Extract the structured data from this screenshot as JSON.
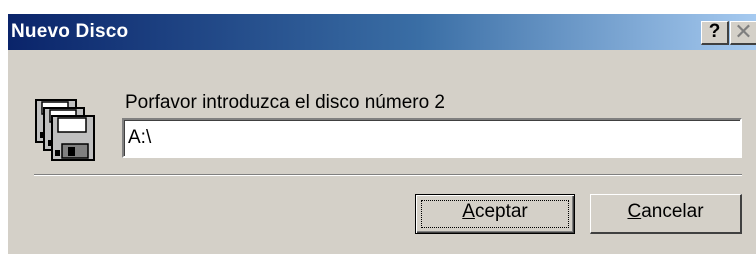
{
  "window": {
    "title": "Nuevo Disco",
    "help_glyph": "?",
    "close_glyph": "✕"
  },
  "icon": "floppy-disks-icon",
  "prompt": "Porfavor introduzca el disco número 2",
  "path_input": {
    "value": "A:\\"
  },
  "buttons": {
    "ok": {
      "mnemonic": "A",
      "rest": "ceptar"
    },
    "cancel": {
      "mnemonic": "C",
      "rest": "ancelar"
    }
  },
  "colors": {
    "titlebar_start": "#0a246a",
    "titlebar_end": "#a6caf0",
    "face": "#d4d0c8"
  }
}
